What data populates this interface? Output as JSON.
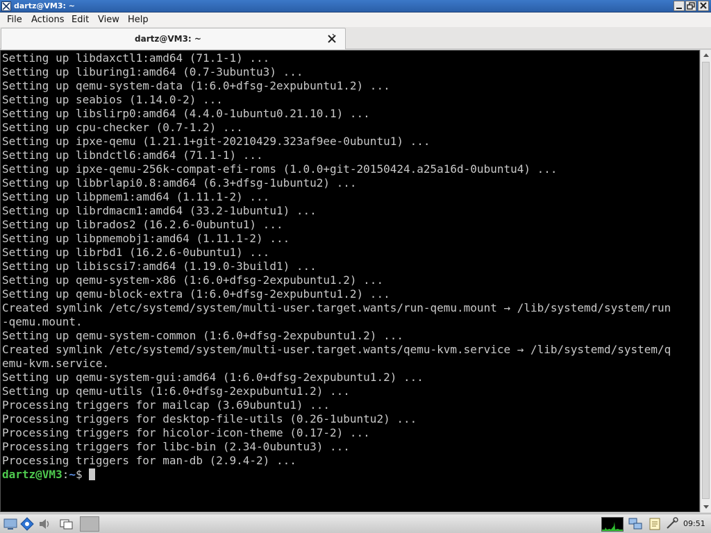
{
  "window": {
    "title": "dartz@VM3: ~",
    "titlebar_color": "#2f66b3"
  },
  "menu": {
    "items": [
      "File",
      "Actions",
      "Edit",
      "View",
      "Help"
    ]
  },
  "tabs": [
    {
      "label": "dartz@VM3: ~",
      "active": true
    }
  ],
  "terminal": {
    "background": "#000000",
    "text_color": "#c9c9c9",
    "lines": [
      "Setting up libdaxctl1:amd64 (71.1-1) ...",
      "Setting up liburing1:amd64 (0.7-3ubuntu3) ...",
      "Setting up qemu-system-data (1:6.0+dfsg-2expubuntu1.2) ...",
      "Setting up seabios (1.14.0-2) ...",
      "Setting up libslirp0:amd64 (4.4.0-1ubuntu0.21.10.1) ...",
      "Setting up cpu-checker (0.7-1.2) ...",
      "Setting up ipxe-qemu (1.21.1+git-20210429.323af9ee-0ubuntu1) ...",
      "Setting up libndctl6:amd64 (71.1-1) ...",
      "Setting up ipxe-qemu-256k-compat-efi-roms (1.0.0+git-20150424.a25a16d-0ubuntu4) ...",
      "Setting up libbrlapi0.8:amd64 (6.3+dfsg-1ubuntu2) ...",
      "Setting up libpmem1:amd64 (1.11.1-2) ...",
      "Setting up librdmacm1:amd64 (33.2-1ubuntu1) ...",
      "Setting up librados2 (16.2.6-0ubuntu1) ...",
      "Setting up libpmemobj1:amd64 (1.11.1-2) ...",
      "Setting up librbd1 (16.2.6-0ubuntu1) ...",
      "Setting up libiscsi7:amd64 (1.19.0-3build1) ...",
      "Setting up qemu-system-x86 (1:6.0+dfsg-2expubuntu1.2) ...",
      "Setting up qemu-block-extra (1:6.0+dfsg-2expubuntu1.2) ...",
      "Created symlink /etc/systemd/system/multi-user.target.wants/run-qemu.mount → /lib/systemd/system/run",
      "-qemu.mount.",
      "Setting up qemu-system-common (1:6.0+dfsg-2expubuntu1.2) ...",
      "Created symlink /etc/systemd/system/multi-user.target.wants/qemu-kvm.service → /lib/systemd/system/q",
      "emu-kvm.service.",
      "Setting up qemu-system-gui:amd64 (1:6.0+dfsg-2expubuntu1.2) ...",
      "Setting up qemu-utils (1:6.0+dfsg-2expubuntu1.2) ...",
      "Processing triggers for mailcap (3.69ubuntu1) ...",
      "Processing triggers for desktop-file-utils (0.26-1ubuntu2) ...",
      "Processing triggers for hicolor-icon-theme (0.17-2) ...",
      "Processing triggers for libc-bin (2.34-0ubuntu3) ...",
      "Processing triggers for man-db (2.9.4-2) ..."
    ],
    "prompt": {
      "user_host": "dartz@VM3",
      "colon": ":",
      "path": "~",
      "symbol": "$ "
    },
    "prompt_user_color": "#4ec94e",
    "prompt_path_color": "#5b8de0"
  },
  "taskbar": {
    "clock": "09:51",
    "icons": [
      "show-desktop-icon",
      "browser-icon",
      "volume-icon",
      "workspace-icon",
      "cpu-monitor-icon",
      "network-icon",
      "notes-icon",
      "clipboard-icon",
      "volume-tray-icon"
    ]
  }
}
